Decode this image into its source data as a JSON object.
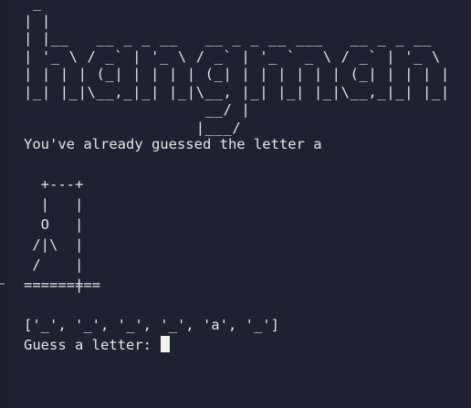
{
  "banner": {
    "ascii": " _\n| |\n| |__   __ _ _ __   __ _ _ __ ___   __ _ _ __\n| '_ \\ / _` | '_ \\ / _` | '_ ` _ \\ / _` | '_ \\\n| | | | (_| | | | | (_| | | | | | | (_| | | | |\n|_| |_|\\__,_|_| |_|\\__, |_| |_| |_|\\__,_|_| |_|\n                    __/ |\n                   |___/"
  },
  "message": "You've already guessed the letter a",
  "gallows": {
    "ascii": "  +---+\n  |   |\n  O   |\n /|\\  |\n /    |\n      |"
  },
  "floor": "=========",
  "board": "['_', '_', '_', '_', 'a', '_']",
  "prompt": "Guess a letter: ",
  "colors": {
    "background": "#1e2130",
    "text": "#e6e6e6",
    "cursor": "#f2f2f2"
  }
}
